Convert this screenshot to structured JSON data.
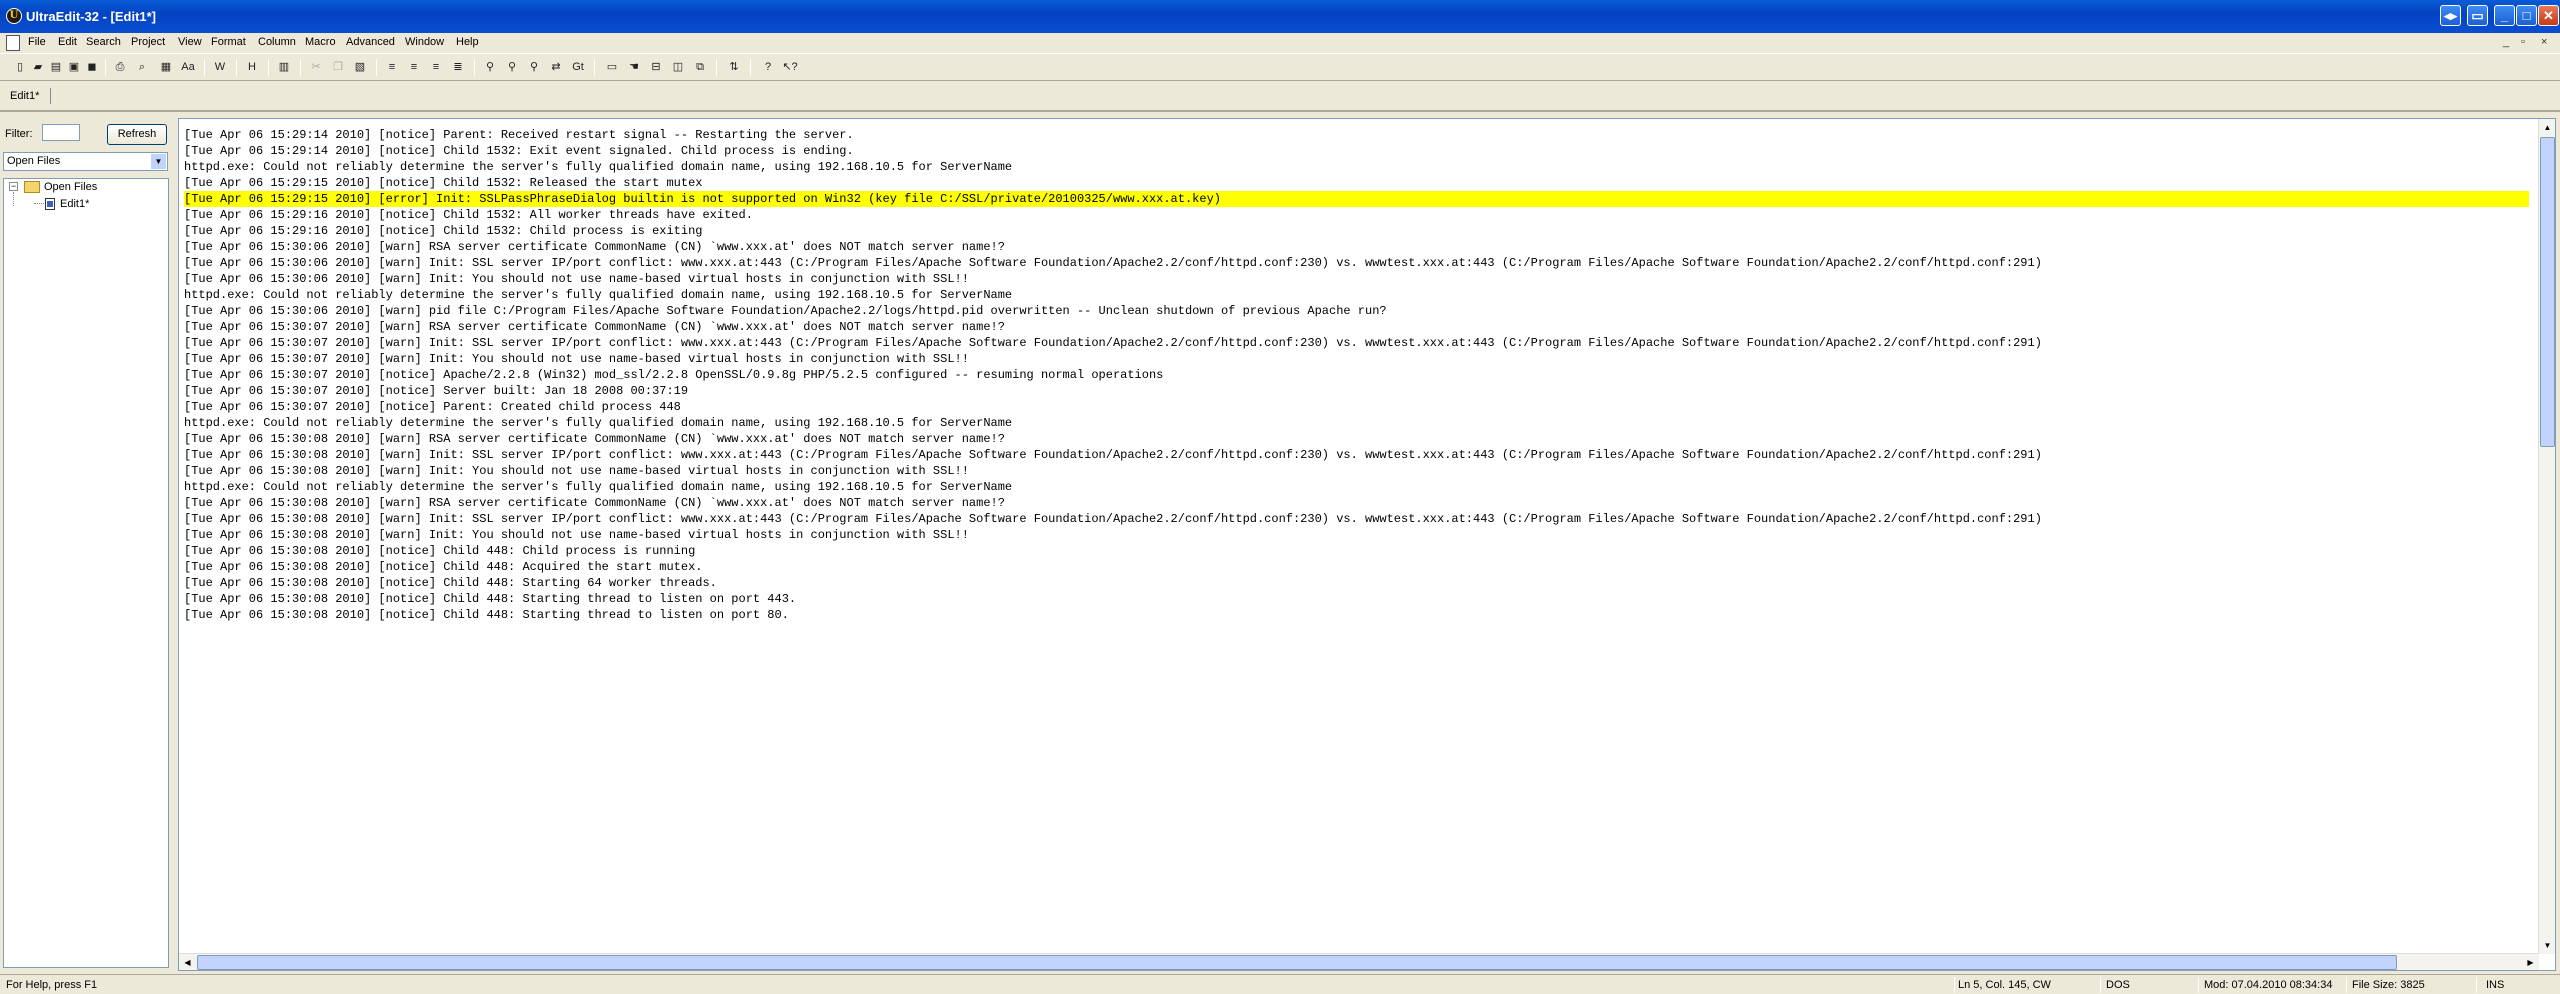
{
  "window": {
    "title": "UltraEdit-32 - [Edit1*]",
    "minimize": "_",
    "maximize": "□",
    "close": "✕"
  },
  "menu": {
    "items": [
      "File",
      "Edit",
      "Search",
      "Project",
      "View",
      "Format",
      "Column",
      "Macro",
      "Advanced",
      "Window",
      "Help"
    ],
    "mdi_minimize": "_",
    "mdi_restore": "▫",
    "mdi_close": "×"
  },
  "tabs": [
    {
      "label": "Edit1*"
    }
  ],
  "leftpane": {
    "filter_label": "Filter:",
    "filter_value": "",
    "refresh_label": "Refresh",
    "view_selected": "Open Files",
    "tree": {
      "root_label": "Open Files",
      "child_label": "Edit1*"
    }
  },
  "editor": {
    "highlight_line_index": 4,
    "lines": [
      "[Tue Apr 06 15:29:14 2010] [notice] Parent: Received restart signal -- Restarting the server.",
      "[Tue Apr 06 15:29:14 2010] [notice] Child 1532: Exit event signaled. Child process is ending.",
      "httpd.exe: Could not reliably determine the server's fully qualified domain name, using 192.168.10.5 for ServerName",
      "[Tue Apr 06 15:29:15 2010] [notice] Child 1532: Released the start mutex",
      "[Tue Apr 06 15:29:15 2010] [error] Init: SSLPassPhraseDialog builtin is not supported on Win32 (key file C:/SSL/private/20100325/www.xxx.at.key)",
      "[Tue Apr 06 15:29:16 2010] [notice] Child 1532: All worker threads have exited.",
      "[Tue Apr 06 15:29:16 2010] [notice] Child 1532: Child process is exiting",
      "[Tue Apr 06 15:30:06 2010] [warn] RSA server certificate CommonName (CN) `www.xxx.at' does NOT match server name!?",
      "[Tue Apr 06 15:30:06 2010] [warn] Init: SSL server IP/port conflict: www.xxx.at:443 (C:/Program Files/Apache Software Foundation/Apache2.2/conf/httpd.conf:230) vs. wwwtest.xxx.at:443 (C:/Program Files/Apache Software Foundation/Apache2.2/conf/httpd.conf:291)",
      "[Tue Apr 06 15:30:06 2010] [warn] Init: You should not use name-based virtual hosts in conjunction with SSL!!",
      "httpd.exe: Could not reliably determine the server's fully qualified domain name, using 192.168.10.5 for ServerName",
      "[Tue Apr 06 15:30:06 2010] [warn] pid file C:/Program Files/Apache Software Foundation/Apache2.2/logs/httpd.pid overwritten -- Unclean shutdown of previous Apache run?",
      "[Tue Apr 06 15:30:07 2010] [warn] RSA server certificate CommonName (CN) `www.xxx.at' does NOT match server name!?",
      "[Tue Apr 06 15:30:07 2010] [warn] Init: SSL server IP/port conflict: www.xxx.at:443 (C:/Program Files/Apache Software Foundation/Apache2.2/conf/httpd.conf:230) vs. wwwtest.xxx.at:443 (C:/Program Files/Apache Software Foundation/Apache2.2/conf/httpd.conf:291)",
      "[Tue Apr 06 15:30:07 2010] [warn] Init: You should not use name-based virtual hosts in conjunction with SSL!!",
      "[Tue Apr 06 15:30:07 2010] [notice] Apache/2.2.8 (Win32) mod_ssl/2.2.8 OpenSSL/0.9.8g PHP/5.2.5 configured -- resuming normal operations",
      "[Tue Apr 06 15:30:07 2010] [notice] Server built: Jan 18 2008 00:37:19",
      "[Tue Apr 06 15:30:07 2010] [notice] Parent: Created child process 448",
      "httpd.exe: Could not reliably determine the server's fully qualified domain name, using 192.168.10.5 for ServerName",
      "[Tue Apr 06 15:30:08 2010] [warn] RSA server certificate CommonName (CN) `www.xxx.at' does NOT match server name!?",
      "[Tue Apr 06 15:30:08 2010] [warn] Init: SSL server IP/port conflict: www.xxx.at:443 (C:/Program Files/Apache Software Foundation/Apache2.2/conf/httpd.conf:230) vs. wwwtest.xxx.at:443 (C:/Program Files/Apache Software Foundation/Apache2.2/conf/httpd.conf:291)",
      "[Tue Apr 06 15:30:08 2010] [warn] Init: You should not use name-based virtual hosts in conjunction with SSL!!",
      "httpd.exe: Could not reliably determine the server's fully qualified domain name, using 192.168.10.5 for ServerName",
      "[Tue Apr 06 15:30:08 2010] [warn] RSA server certificate CommonName (CN) `www.xxx.at' does NOT match server name!?",
      "[Tue Apr 06 15:30:08 2010] [warn] Init: SSL server IP/port conflict: www.xxx.at:443 (C:/Program Files/Apache Software Foundation/Apache2.2/conf/httpd.conf:230) vs. wwwtest.xxx.at:443 (C:/Program Files/Apache Software Foundation/Apache2.2/conf/httpd.conf:291)",
      "[Tue Apr 06 15:30:08 2010] [warn] Init: You should not use name-based virtual hosts in conjunction with SSL!!",
      "[Tue Apr 06 15:30:08 2010] [notice] Child 448: Child process is running",
      "[Tue Apr 06 15:30:08 2010] [notice] Child 448: Acquired the start mutex.",
      "[Tue Apr 06 15:30:08 2010] [notice] Child 448: Starting 64 worker threads.",
      "[Tue Apr 06 15:30:08 2010] [notice] Child 448: Starting thread to listen on port 443.",
      "[Tue Apr 06 15:30:08 2010] [notice] Child 448: Starting thread to listen on port 80."
    ]
  },
  "status": {
    "help": "For Help, press F1",
    "position": "Ln 5, Col. 145, CW",
    "line_ending": "DOS",
    "modified": "Mod: 07.04.2010 08:34:34",
    "file_size": "File Size: 3825",
    "insert_mode": "INS"
  },
  "colors": {
    "highlight": "#ffff00",
    "titlebar": "#0a4ed0"
  }
}
